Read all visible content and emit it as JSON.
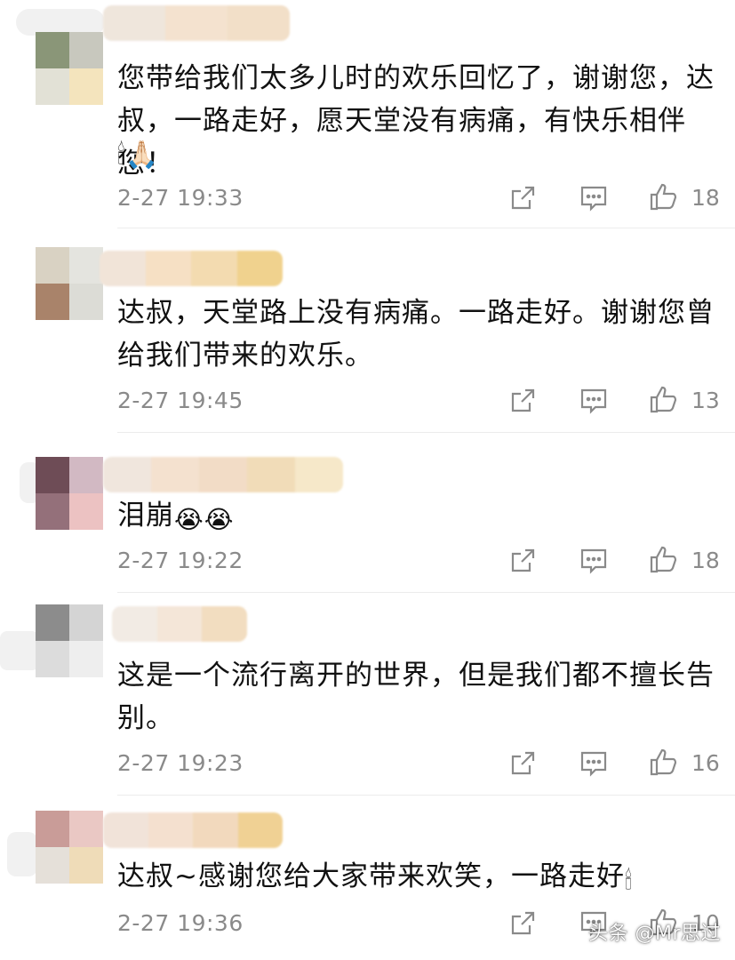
{
  "comments": [
    {
      "text": "您带给我们太多儿时的欢乐回忆了，谢谢您，达叔，一路走好，愿天堂没有病痛，有快乐相伴您！",
      "emojis": "🕯🙏🏻",
      "time": "2-27 19:33",
      "likes": "18",
      "avatar_colors": [
        "#8a9678",
        "#c8c8be",
        "#e2e1d6",
        "#f4e4bd"
      ],
      "username_colors": [
        "#efe6dc",
        "#f4e2cf",
        "#f2dfc8"
      ]
    },
    {
      "text": "达叔，天堂路上没有病痛。一路走好。谢谢您曾给我们带来的欢乐。",
      "emojis": "",
      "time": "2-27 19:45",
      "likes": "13",
      "avatar_colors": [
        "#d9d2c3",
        "#e4e4df",
        "#a9836a",
        "#dcdcd6"
      ],
      "username_colors": [
        "#f1e4d8",
        "#f6e0c4",
        "#f3dbb0",
        "#f0d28e"
      ]
    },
    {
      "text": "泪崩",
      "emojis": "😭😭",
      "time": "2-27 19:22",
      "likes": "18",
      "avatar_colors": [
        "#6e4c56",
        "#d2b9c3",
        "#94707a",
        "#ecc2c2"
      ],
      "username_colors": [
        "#f0e6dd",
        "#f4e1cf",
        "#f2dcc6",
        "#f1dcb8",
        "#f6e8c9"
      ]
    },
    {
      "text": "这是一个流行离开的世界，但是我们都不擅长告别。",
      "emojis": "",
      "time": "2-27 19:23",
      "likes": "16",
      "avatar_colors": [
        "#8c8c8c",
        "#d4d4d4",
        "#dcdcdc",
        "#eeeeee"
      ],
      "username_colors": [
        "#f2ebe4",
        "#f4e6d8",
        "#f2ddc0"
      ]
    },
    {
      "text": "达叔~感谢您给大家带来欢笑，一路走好",
      "emojis": "🕯",
      "time": "2-27 19:36",
      "likes": "10",
      "avatar_colors": [
        "#c99c98",
        "#eac8c4",
        "#e5e0d9",
        "#efdcb8"
      ],
      "username_colors": [
        "#f1e3d9",
        "#f4e0cf",
        "#f2d9bd",
        "#f0d194"
      ]
    }
  ],
  "icons": {
    "share": "share-icon",
    "comment": "comment-icon",
    "like": "thumbs-up-icon"
  },
  "watermark": "头条 @Mr思过"
}
